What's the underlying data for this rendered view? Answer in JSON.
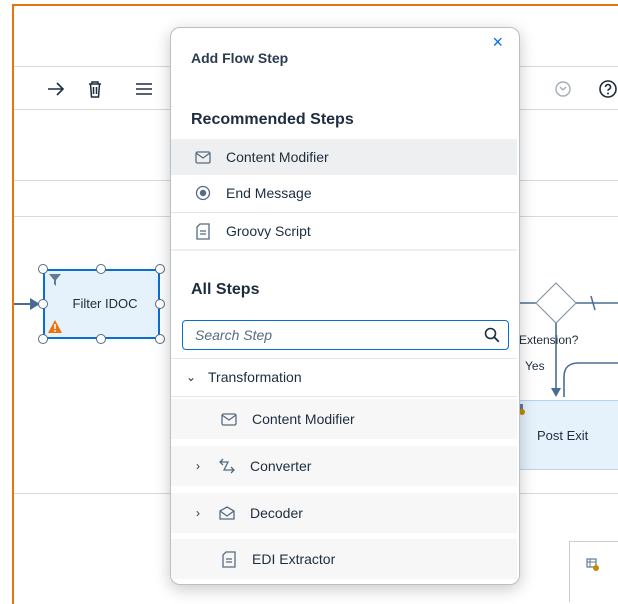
{
  "colors": {
    "accent": "#0a6ed1",
    "frame": "#e9730c",
    "node_fill": "#e5f2fb",
    "warning": "#e9730c"
  },
  "toolbar": {
    "icons": [
      "arrow-right-icon",
      "delete-icon",
      "menu-icon",
      "undo-icon",
      "help-icon"
    ]
  },
  "diagram": {
    "filter_node_label": "Filter IDOC",
    "gateway_label": "Extension?",
    "yes_label": "Yes",
    "post_exit_label": "Post Exit"
  },
  "popover": {
    "title": "Add Flow Step",
    "close_label": "×",
    "recommended_heading": "Recommended Steps",
    "recommended": [
      {
        "label": "Content Modifier",
        "icon": "envelope-icon"
      },
      {
        "label": "End Message",
        "icon": "end-message-icon"
      },
      {
        "label": "Groovy Script",
        "icon": "script-icon"
      }
    ],
    "all_heading": "All Steps",
    "search_placeholder": "Search Step",
    "tree": {
      "category": "Transformation",
      "items": [
        {
          "label": "Content Modifier",
          "icon": "envelope-icon",
          "expandable": false
        },
        {
          "label": "Converter",
          "icon": "converter-icon",
          "expandable": true
        },
        {
          "label": "Decoder",
          "icon": "decoder-icon",
          "expandable": true
        },
        {
          "label": "EDI Extractor",
          "icon": "script-icon",
          "expandable": false
        }
      ]
    }
  }
}
